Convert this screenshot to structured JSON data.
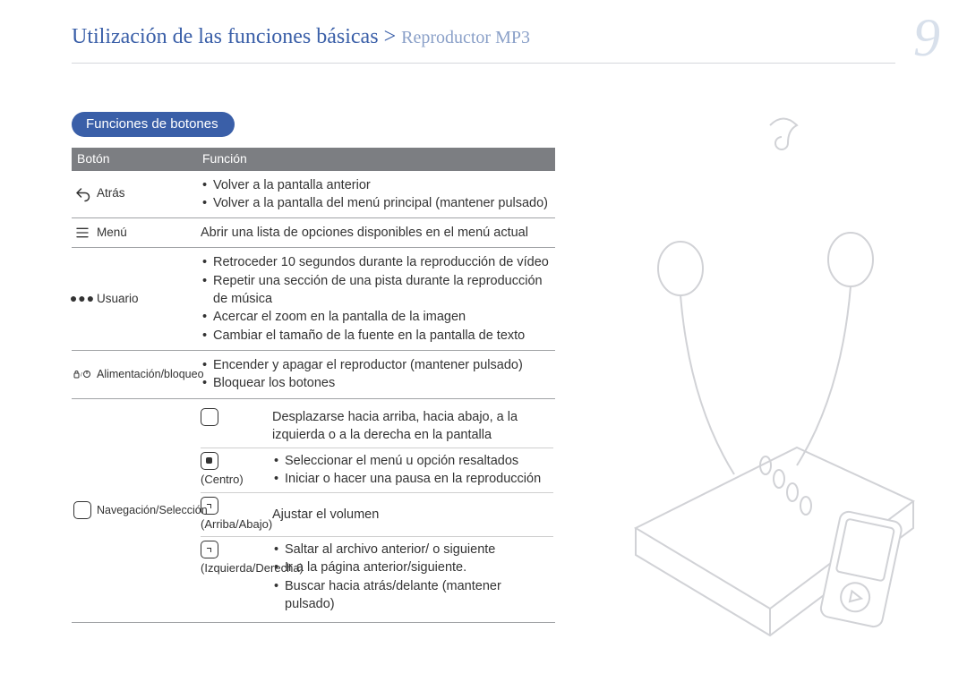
{
  "header": {
    "title_main": "Utilización de las funciones básicas",
    "title_sub": "Reproductor MP3",
    "page_number": "9"
  },
  "subheader": "Funciones de botones",
  "table": {
    "head": {
      "col1": "Botón",
      "col2": "Función"
    },
    "rows": [
      {
        "icon": "back",
        "label": "Atrás",
        "func_bullets": [
          "Volver a la pantalla anterior",
          "Volver a la pantalla del menú principal (mantener pulsado)"
        ]
      },
      {
        "icon": "menu",
        "label": "Menú",
        "func_plain": "Abrir una lista de opciones disponibles en el menú actual"
      },
      {
        "icon": "user",
        "label": "Usuario",
        "func_bullets": [
          "Retroceder 10 segundos durante la reproducción de vídeo",
          "Repetir una sección de una pista durante la reproducción de música",
          "Acercar el zoom en la pantalla de la imagen",
          "Cambiar el tamaño de la fuente en la pantalla de texto"
        ]
      },
      {
        "icon": "power",
        "label": "Alimentación/bloqueo",
        "func_bullets": [
          "Encender y apagar el reproductor (mantener pulsado)",
          "Bloquear los botones"
        ]
      }
    ],
    "nav": {
      "icon": "nav",
      "label": "Navegación/Selección",
      "subrows": [
        {
          "sub_icon": "",
          "sub_label": "",
          "text_plain": "Desplazarse hacia arriba, hacia abajo, a la izquierda o a la derecha en la pantalla"
        },
        {
          "sub_icon": "center",
          "sub_label": "(Centro)",
          "text_bullets": [
            "Seleccionar el menú u opción resaltados",
            "Iniciar o hacer una pausa en la reproducción"
          ]
        },
        {
          "sub_icon": "updown",
          "sub_label": "(Arriba/Abajo)",
          "text_plain": "Ajustar el volumen"
        },
        {
          "sub_icon": "leftright",
          "sub_label": "(Izquierda/Derecha)",
          "text_bullets": [
            "Saltar al archivo anterior/ o siguiente",
            "Ir a la página anterior/siguiente.",
            "Buscar hacia atrás/delante (mantener pulsado)"
          ]
        }
      ]
    }
  }
}
